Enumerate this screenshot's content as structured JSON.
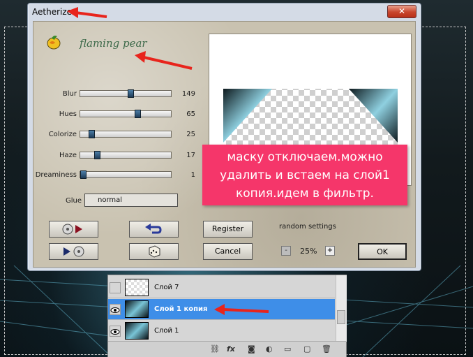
{
  "dialog": {
    "title": "Aetherize",
    "close_label": "✕",
    "brand": "flaming pear"
  },
  "sliders": [
    {
      "label": "Blur",
      "value": "149",
      "fraction": 0.56
    },
    {
      "label": "Hues",
      "value": "65",
      "fraction": 0.64
    },
    {
      "label": "Colorize",
      "value": "25",
      "fraction": 0.1
    },
    {
      "label": "Haze",
      "value": "17",
      "fraction": 0.16
    },
    {
      "label": "Dreaminess",
      "value": "1",
      "fraction": 0.0
    }
  ],
  "glue": {
    "label": "Glue",
    "value": "normal"
  },
  "buttons": {
    "register": "Register",
    "cancel": "Cancel",
    "ok": "OK",
    "random_settings": "random settings"
  },
  "zoom": {
    "minus": "-",
    "value": "25%",
    "plus": "+"
  },
  "annotation": {
    "text": "маску отключаем.можно удалить и встаем на слой1 копия.идем в фильтр."
  },
  "layers": [
    {
      "name": "Слой 7",
      "visible": false,
      "selected": false
    },
    {
      "name": "Слой 1 копия",
      "visible": true,
      "selected": true
    },
    {
      "name": "Слой 1",
      "visible": true,
      "selected": false
    }
  ],
  "colors": {
    "annotation_bg": "#f5366a",
    "selected_layer": "#3e8ee8",
    "arrow": "#e8241c"
  }
}
